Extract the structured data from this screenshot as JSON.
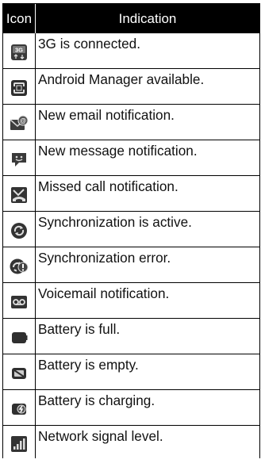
{
  "header": {
    "icon_col": "Icon",
    "indication_col": "Indication"
  },
  "rows": [
    {
      "icon": "3g-icon",
      "text": "3G is connected."
    },
    {
      "icon": "android-manager-icon",
      "text": "Android Manager available."
    },
    {
      "icon": "email-icon",
      "text": "New email notification."
    },
    {
      "icon": "message-icon",
      "text": "New message notification."
    },
    {
      "icon": "missed-call-icon",
      "text": "Missed call notification."
    },
    {
      "icon": "sync-icon",
      "text": "Synchronization is active."
    },
    {
      "icon": "sync-error-icon",
      "text": "Synchronization error."
    },
    {
      "icon": "voicemail-icon",
      "text": "Voicemail notification."
    },
    {
      "icon": "battery-full-icon",
      "text": "Battery is full."
    },
    {
      "icon": "battery-empty-icon",
      "text": "Battery is empty."
    },
    {
      "icon": "battery-charging-icon",
      "text": "Battery is charging."
    },
    {
      "icon": "signal-icon",
      "text": "Network signal level."
    }
  ]
}
